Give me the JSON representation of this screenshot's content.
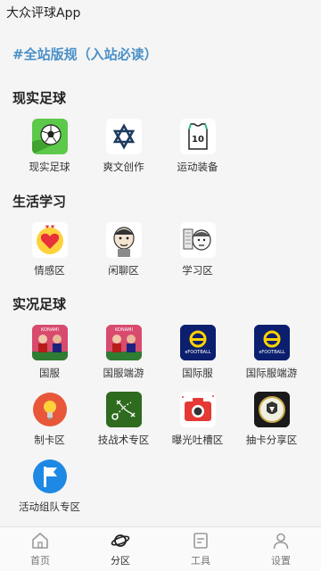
{
  "app_title": "大众评球App",
  "pinned_link": "#全站版规（入站必读）",
  "sections": [
    {
      "title": "现实足球",
      "items": [
        {
          "label": "现实足球",
          "icon": "soccer-ball-icon"
        },
        {
          "label": "爽文创作",
          "icon": "star-of-david-icon"
        },
        {
          "label": "运动装备",
          "icon": "jersey-icon"
        }
      ]
    },
    {
      "title": "生活学习",
      "items": [
        {
          "label": "情感区",
          "icon": "heart-sticker-icon"
        },
        {
          "label": "闲聊区",
          "icon": "cartoon-face-icon"
        },
        {
          "label": "学习区",
          "icon": "sketch-face-icon"
        }
      ]
    },
    {
      "title": "实况足球",
      "items": [
        {
          "label": "国服",
          "icon": "konami-poster-icon"
        },
        {
          "label": "国服端游",
          "icon": "konami-poster-icon"
        },
        {
          "label": "国际服",
          "icon": "efootball-icon"
        },
        {
          "label": "国际服端游",
          "icon": "efootball-icon"
        },
        {
          "label": "制卡区",
          "icon": "lightbulb-icon"
        },
        {
          "label": "技战术专区",
          "icon": "tactics-board-icon"
        },
        {
          "label": "曝光吐槽区",
          "icon": "camera-icon"
        },
        {
          "label": "抽卡分享区",
          "icon": "card-badge-icon"
        },
        {
          "label": "活动组队专区",
          "icon": "flag-icon"
        }
      ]
    }
  ],
  "tabbar": [
    {
      "label": "首页",
      "icon": "home-icon",
      "active": false
    },
    {
      "label": "分区",
      "icon": "planet-icon",
      "active": true
    },
    {
      "label": "工具",
      "icon": "document-icon",
      "active": false
    },
    {
      "label": "设置",
      "icon": "user-icon",
      "active": false
    }
  ],
  "colors": {
    "accent": "#4a90c8",
    "background": "#f5f5f5"
  },
  "efootball_text": "eFOOTBALL",
  "konami_text": "KONAMI"
}
